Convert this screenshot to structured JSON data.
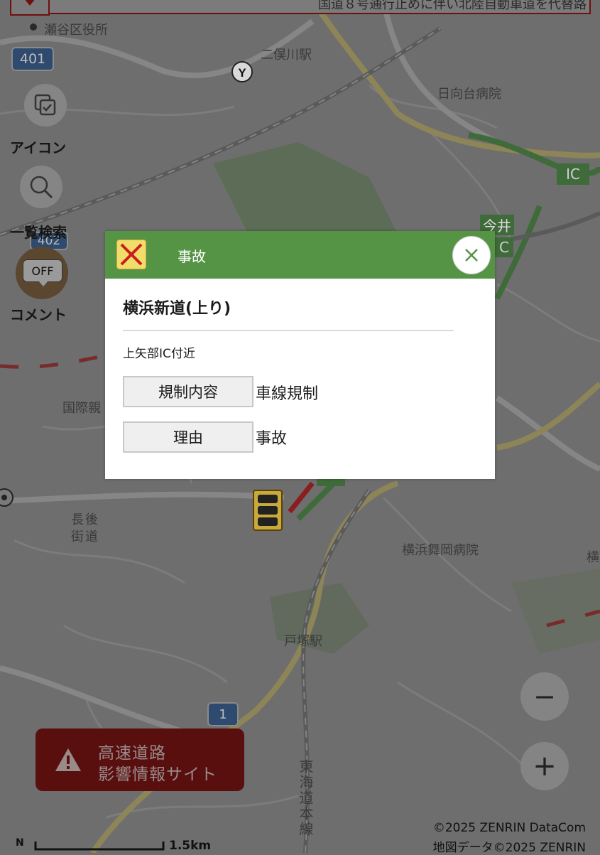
{
  "banner": {
    "text": "国道８号通行止めに伴い北陸自動車道を代替路"
  },
  "map": {
    "poi_labels": [
      {
        "id": "seya-ward-office",
        "text": "瀬谷区役所"
      },
      {
        "id": "futamatagawa-station",
        "text": "二俣川駅"
      },
      {
        "id": "hinatadai-hospital",
        "text": "日向台病院"
      },
      {
        "id": "imai-ic",
        "text": "今井"
      },
      {
        "id": "kokusai",
        "text": "国際親"
      },
      {
        "id": "nagago-kaido",
        "text": "長後街道"
      },
      {
        "id": "yokohama-maioka-hospital",
        "text": "横浜舞岡病院"
      },
      {
        "id": "totsuka-station",
        "text": "戸塚駅"
      },
      {
        "id": "tokaido-line",
        "text": "東海道本線"
      },
      {
        "id": "edge-yoko",
        "text": "横"
      }
    ],
    "route_shields": [
      {
        "id": "route-401",
        "text": "401"
      },
      {
        "id": "route-402",
        "text": "402"
      },
      {
        "id": "route-1",
        "text": "1"
      }
    ],
    "ic_badges": [
      {
        "id": "ic-badge-right",
        "text": "IC"
      },
      {
        "id": "ic-badge-imai",
        "text": "C"
      }
    ]
  },
  "tools": {
    "icon_label": "アイコン",
    "list_search_label": "一覧検索",
    "comment_label": "コメント",
    "comment_toggle": "OFF"
  },
  "popup": {
    "title": "事故",
    "road_name": "横浜新道(上り)",
    "location": "上矢部IC付近",
    "rows": [
      {
        "label": "規制内容",
        "value": "車線規制"
      },
      {
        "label": "理由",
        "value": "事故"
      }
    ]
  },
  "highway_banner": {
    "line1": "高速道路",
    "line2": "影響情報サイト"
  },
  "zoom": {
    "minus": "−",
    "plus": "+"
  },
  "attribution": {
    "line1": "©2025 ZENRIN DataCom",
    "line2": "地図データ©2025 ZENRIN"
  },
  "scale": {
    "text": "1.5km",
    "north": "N"
  },
  "colors": {
    "popup_header": "#559345",
    "overlay_tint": "#6f6f6f",
    "highway_banner": "#5a0f0f"
  }
}
